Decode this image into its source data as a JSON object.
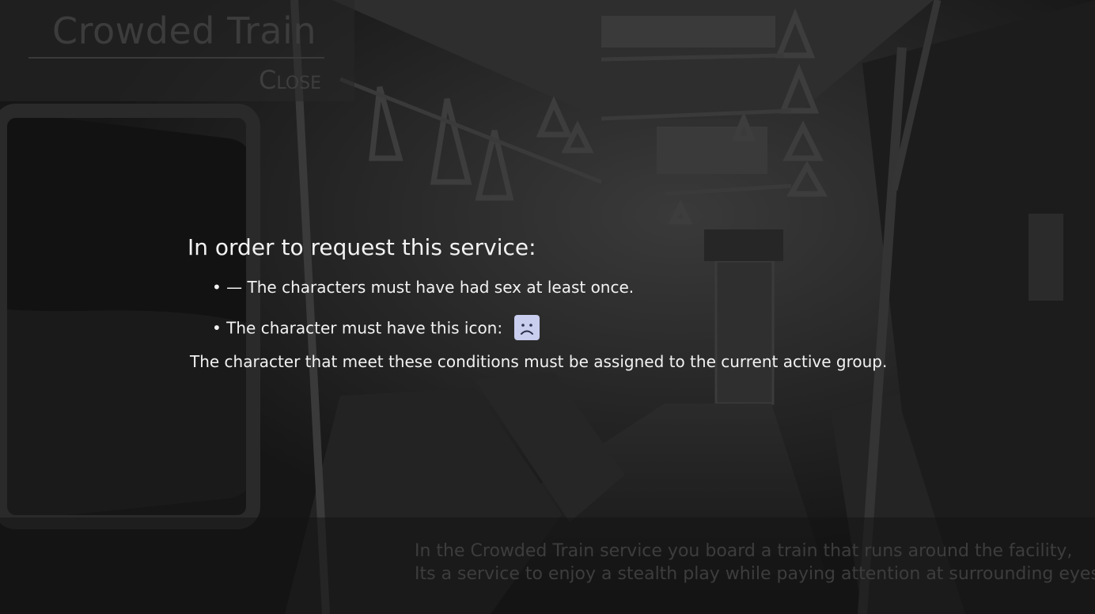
{
  "header": {
    "title": "Crowded Train",
    "close_label": "Close"
  },
  "requirements": {
    "heading": "In order to request this service:",
    "items": [
      "• — The characters must have had sex at least once.",
      "• The character must have this icon:"
    ],
    "required_icon": "sad-face-icon",
    "footer": "The character that meet these conditions must be assigned to the current active group."
  },
  "description": {
    "lines": [
      "In the Crowded Train service you board a train that runs around the facility,",
      "Its a service to enjoy a stealth play while paying attention at surrounding eyes."
    ]
  },
  "colors": {
    "text_primary": "#f2f2f2",
    "text_dim": "#3d3d3d",
    "icon_bg": "#c9cdee",
    "icon_stroke": "#2a2f4a"
  }
}
